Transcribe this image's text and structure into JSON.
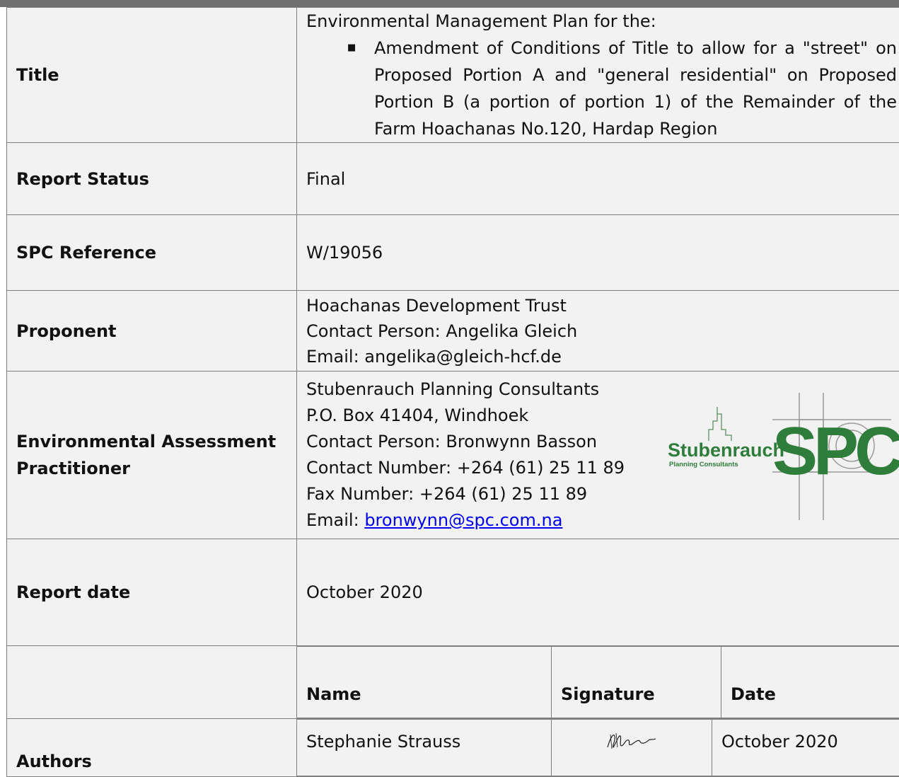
{
  "title_row": {
    "label": "Title",
    "intro": "Environmental Management Plan for the:",
    "bullet": "Amendment of Conditions of Title to allow for a \"street\" on Proposed Portion A and \"general residential\" on Proposed Portion B (a portion of portion 1) of the Remainder of the Farm Hoachanas No.120, Hardap Region"
  },
  "status_row": {
    "label": "Report Status",
    "value": "Final"
  },
  "reference_row": {
    "label": "SPC Reference",
    "value": "W/19056"
  },
  "proponent_row": {
    "label": "Proponent",
    "lines": [
      "Hoachanas Development Trust",
      "Contact Person: Angelika Gleich",
      "Email: angelika@gleich-hcf.de"
    ]
  },
  "eap_row": {
    "label_line1": "Environmental Assessment",
    "label_line2": "Practitioner",
    "lines": [
      "Stubenrauch Planning Consultants",
      "P.O. Box 41404, Windhoek",
      "Contact Person: Bronwynn Basson",
      "Contact Number: +264 (61) 25 11 89",
      "Fax Number: +264 (61) 25 11 89"
    ],
    "email_prefix": "Email: ",
    "email_link": "bronwynn@spc.com.na",
    "logo": {
      "name": "Stubenrauch",
      "subtitle": "Planning Consultants",
      "mark": "SPC",
      "color": "#2e7d3a"
    }
  },
  "date_row": {
    "label": "Report date",
    "value": "October 2020"
  },
  "authors_table": {
    "headers": [
      "Name",
      "Signature",
      "Date"
    ],
    "label": "Authors",
    "rows": [
      {
        "name": "Stephanie Strauss",
        "date": "October 2020"
      }
    ]
  },
  "colors": {
    "cell_bg": "#f2f2f2",
    "border": "#7f7f7f",
    "link": "#0000ee",
    "top_bar": "#6f6f6f"
  }
}
